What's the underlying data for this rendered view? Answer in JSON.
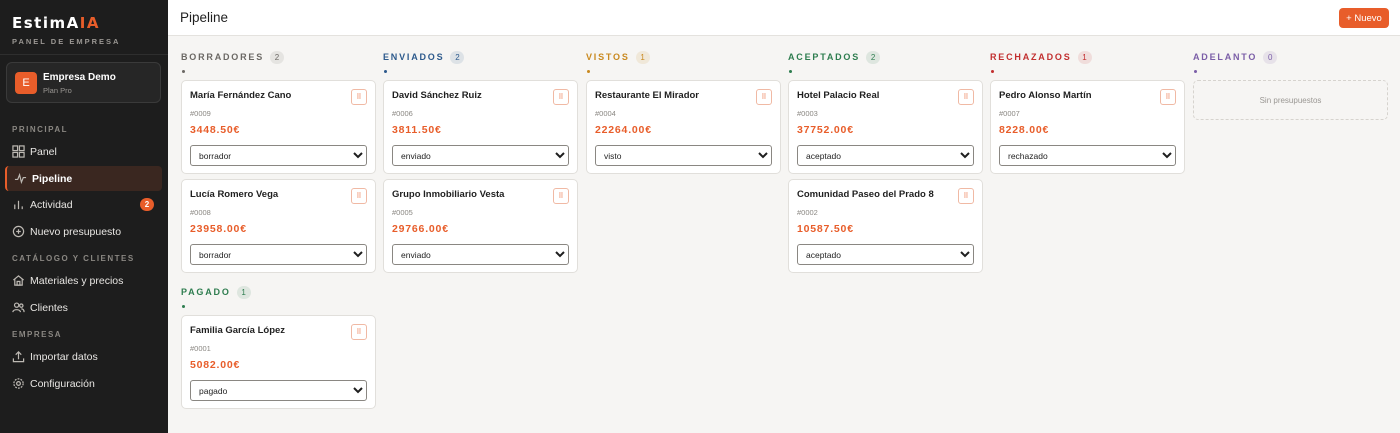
{
  "app": {
    "logo_main": "EstimA",
    "logo_accent": "IA",
    "logo_subtitle": "PANEL DE EMPRESA"
  },
  "company": {
    "initial": "E",
    "name": "Empresa Demo",
    "plan": "Plan Pro"
  },
  "sidebar": {
    "sections": {
      "principal": "PRINCIPAL",
      "catalogo": "CATÁLOGO Y CLIENTES",
      "empresa": "EMPRESA"
    },
    "items": [
      {
        "label": "Panel",
        "icon": "grid-icon"
      },
      {
        "label": "Pipeline",
        "icon": "activity-icon",
        "active": true
      },
      {
        "label": "Actividad",
        "icon": "bar-chart-icon",
        "badge": "2"
      },
      {
        "label": "Nuevo presupuesto",
        "icon": "plus-circle-icon"
      },
      {
        "label": "Materiales y precios",
        "icon": "home-icon"
      },
      {
        "label": "Clientes",
        "icon": "users-icon"
      },
      {
        "label": "Importar datos",
        "icon": "upload-icon"
      },
      {
        "label": "Configuración",
        "icon": "gear-icon"
      }
    ]
  },
  "header": {
    "title": "Pipeline",
    "new_button": "+ Nuevo"
  },
  "colors": {
    "accent": "#e85d2a",
    "borradores": "#6b6864",
    "enviados": "#2d5a8c",
    "vistos": "#c9891f",
    "aceptados": "#2e7d4f",
    "rechazados": "#c22f2f",
    "adelanto": "#7b5ea7",
    "pagado": "#2e7d4f"
  },
  "columns": [
    {
      "title": "BORRADORES",
      "count": "2",
      "cards": [
        {
          "client": "María Fernández Cano",
          "ref": "#0009",
          "amount": "3448.50€",
          "status": "borrador"
        },
        {
          "client": "Lucía Romero Vega",
          "ref": "#0008",
          "amount": "23958.00€",
          "status": "borrador"
        }
      ]
    },
    {
      "title": "ENVIADOS",
      "count": "2",
      "cards": [
        {
          "client": "David Sánchez Ruiz",
          "ref": "#0006",
          "amount": "3811.50€",
          "status": "enviado"
        },
        {
          "client": "Grupo Inmobiliario Vesta",
          "ref": "#0005",
          "amount": "29766.00€",
          "status": "enviado"
        }
      ]
    },
    {
      "title": "VISTOS",
      "count": "1",
      "cards": [
        {
          "client": "Restaurante El Mirador",
          "ref": "#0004",
          "amount": "22264.00€",
          "status": "visto"
        }
      ]
    },
    {
      "title": "ACEPTADOS",
      "count": "2",
      "cards": [
        {
          "client": "Hotel Palacio Real",
          "ref": "#0003",
          "amount": "37752.00€",
          "status": "aceptado"
        },
        {
          "client": "Comunidad Paseo del Prado 8",
          "ref": "#0002",
          "amount": "10587.50€",
          "status": "aceptado"
        }
      ]
    },
    {
      "title": "RECHAZADOS",
      "count": "1",
      "cards": [
        {
          "client": "Pedro Alonso Martín",
          "ref": "#0007",
          "amount": "8228.00€",
          "status": "rechazado"
        }
      ]
    },
    {
      "title": "ADELANTO",
      "count": "0",
      "empty_text": "Sin presupuestos",
      "cards": []
    },
    {
      "title": "PAGADO",
      "count": "1",
      "cards": [
        {
          "client": "Familia García López",
          "ref": "#0001",
          "amount": "5082.00€",
          "status": "pagado"
        }
      ]
    }
  ],
  "handle_glyph": "⠿",
  "status_options": [
    "borrador",
    "enviado",
    "visto",
    "aceptado",
    "rechazado",
    "adelanto",
    "pagado"
  ]
}
